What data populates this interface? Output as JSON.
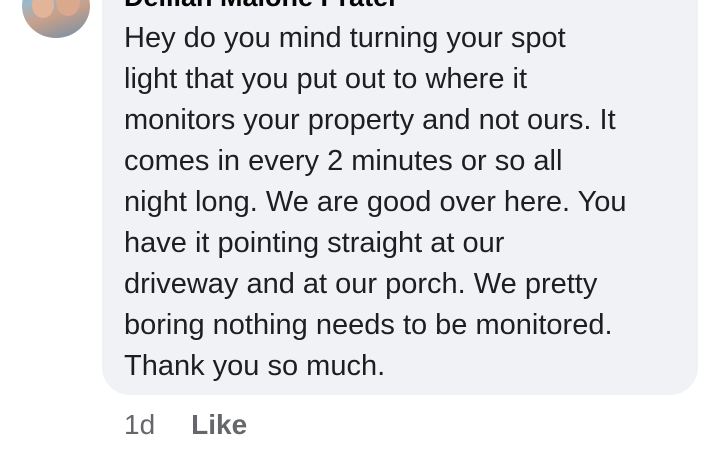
{
  "comment": {
    "author": "Delilah Malone Prater",
    "lines": [
      "Hey do you mind turning your spot",
      "light that you put out to where it",
      "monitors your property and not ours. It",
      "comes in every 2 minutes or so all",
      "night long. We are good over here. You",
      "have it pointing straight at our",
      "driveway and at our porch. We pretty",
      "boring nothing needs to be monitored.",
      "Thank you so much."
    ],
    "timestamp": "1d",
    "like_label": "Like"
  },
  "colors": {
    "bubble_bg": "#f0f2f5",
    "text": "#1c1e21",
    "meta_text": "#65676b"
  }
}
